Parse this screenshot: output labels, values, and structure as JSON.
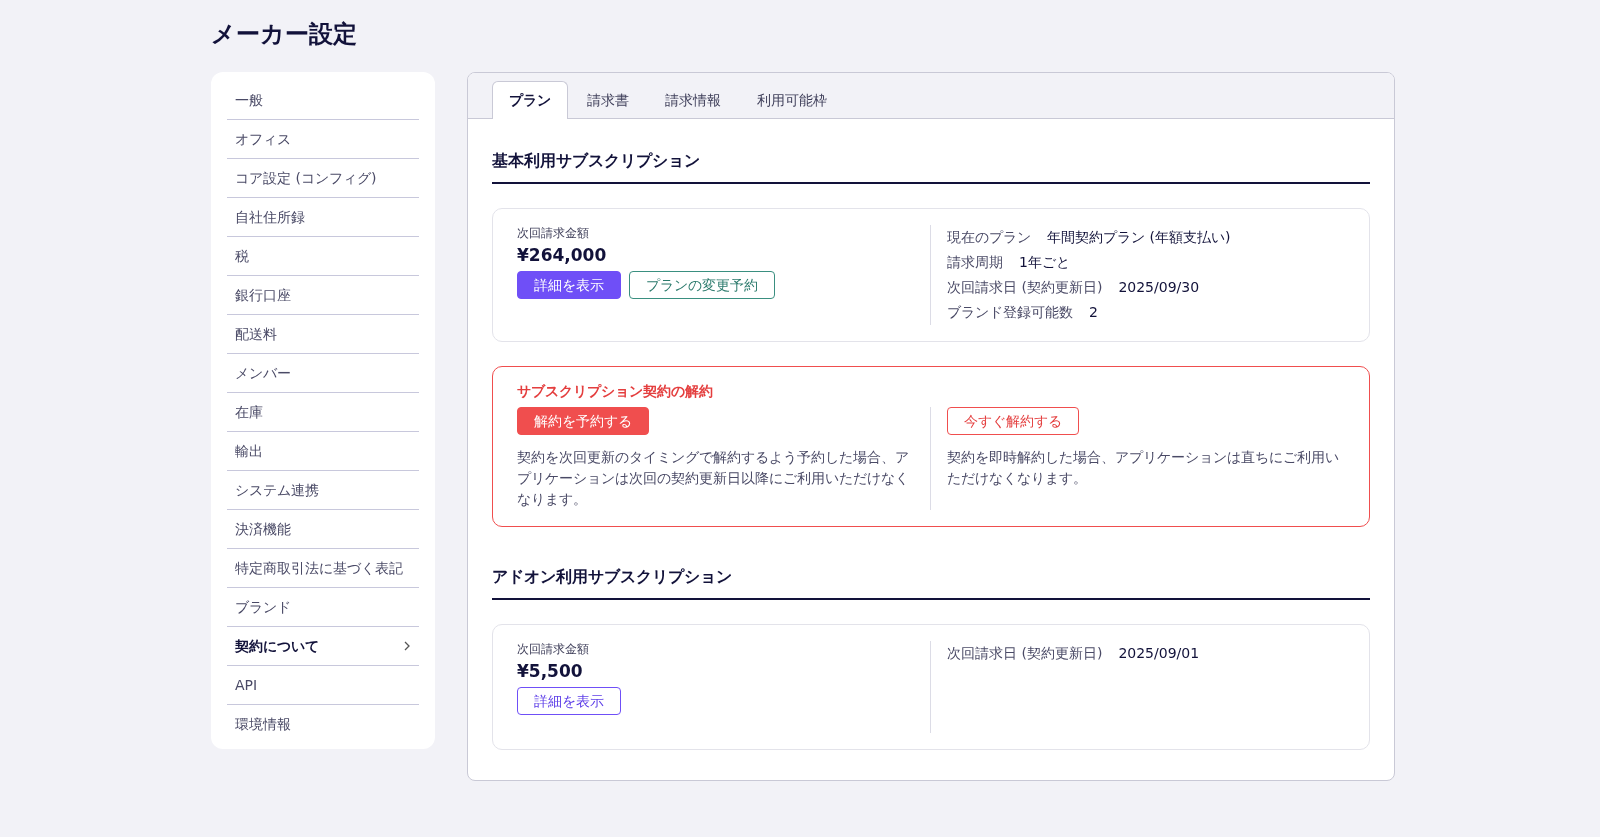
{
  "page_title": "メーカー設定",
  "sidebar": {
    "items": [
      {
        "label": "一般",
        "selected": false
      },
      {
        "label": "オフィス",
        "selected": false
      },
      {
        "label": "コア設定 (コンフィグ)",
        "selected": false
      },
      {
        "label": "自社住所録",
        "selected": false
      },
      {
        "label": "税",
        "selected": false
      },
      {
        "label": "銀行口座",
        "selected": false
      },
      {
        "label": "配送料",
        "selected": false
      },
      {
        "label": "メンバー",
        "selected": false
      },
      {
        "label": "在庫",
        "selected": false
      },
      {
        "label": "輸出",
        "selected": false
      },
      {
        "label": "システム連携",
        "selected": false
      },
      {
        "label": "決済機能",
        "selected": false
      },
      {
        "label": "特定商取引法に基づく表記",
        "selected": false
      },
      {
        "label": "ブランド",
        "selected": false
      },
      {
        "label": "契約について",
        "selected": true
      },
      {
        "label": "API",
        "selected": false
      },
      {
        "label": "環境情報",
        "selected": false
      }
    ]
  },
  "tabs": [
    {
      "label": "プラン",
      "selected": true
    },
    {
      "label": "請求書",
      "selected": false
    },
    {
      "label": "請求情報",
      "selected": false
    },
    {
      "label": "利用可能枠",
      "selected": false
    }
  ],
  "sections": [
    {
      "title": "基本利用サブスクリプション",
      "summary": {
        "label": "次回請求金額",
        "amount": "¥264,000",
        "buttons": [
          {
            "label": "詳細を表示",
            "kind": "primary"
          },
          {
            "label": "プランの変更予約",
            "kind": "teal"
          }
        ]
      },
      "details": [
        {
          "label": "現在のプラン",
          "value": "年間契約プラン (年額支払い)"
        },
        {
          "label": "請求周期",
          "value": "1年ごと"
        },
        {
          "label": "次回請求日 (契約更新日)",
          "value": "2025/09/30"
        },
        {
          "label": "ブランド登録可能数",
          "value": "2"
        }
      ],
      "cancellation": {
        "title": "サブスクリプション契約の解約",
        "options": [
          {
            "button": "解約を予約する",
            "kind": "solid",
            "text": "契約を次回更新のタイミングで解約するよう予約した場合、アプリケーションは次回の契約更新日以降にご利用いただけなくなります。"
          },
          {
            "button": "今すぐ解約する",
            "kind": "outline",
            "text": "契約を即時解約した場合、アプリケーションは直ちにご利用いただけなくなります。"
          }
        ]
      }
    },
    {
      "title": "アドオン利用サブスクリプション",
      "summary": {
        "label": "次回請求金額",
        "amount": "¥5,500",
        "buttons": [
          {
            "label": "詳細を表示",
            "kind": "violet"
          }
        ]
      },
      "details": [
        {
          "label": "次回請求日 (契約更新日)",
          "value": "2025/09/01"
        }
      ]
    }
  ]
}
